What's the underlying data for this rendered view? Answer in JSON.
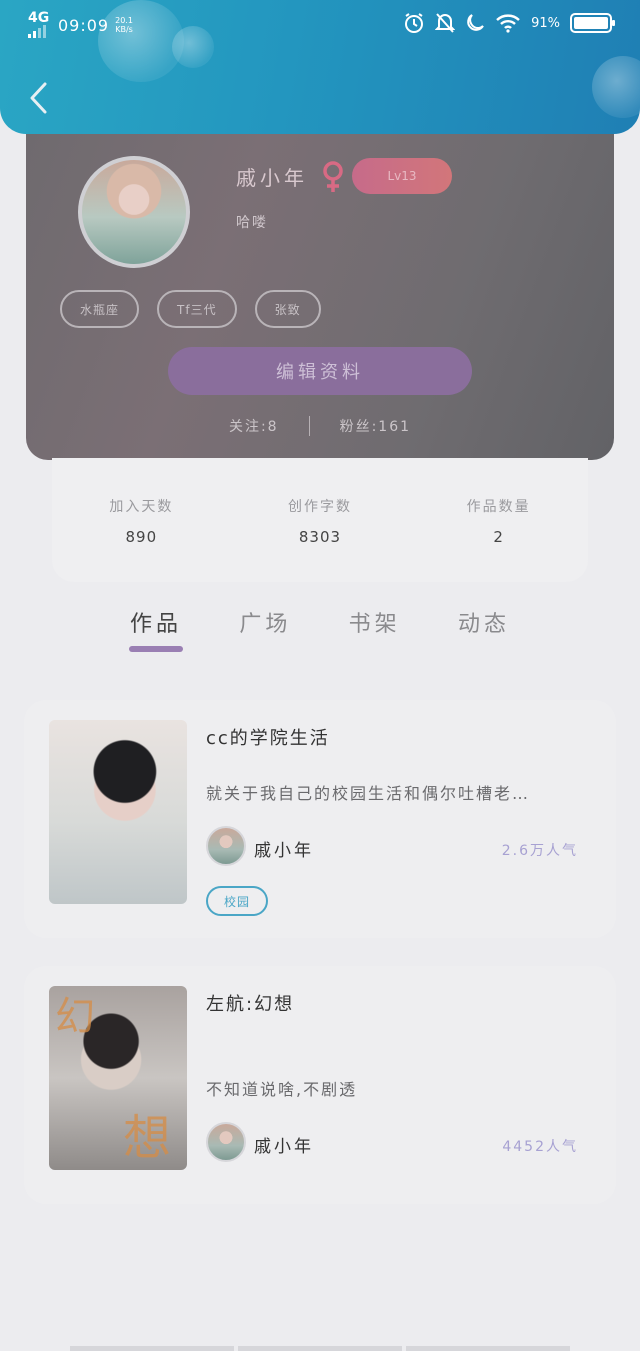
{
  "status_bar": {
    "network": "4G",
    "time": "09:09",
    "speed_value": "20.1",
    "speed_unit": "KB/s",
    "battery": "91%"
  },
  "header": {
    "back_icon": "chevron-left-icon"
  },
  "profile": {
    "nickname": "戚小年",
    "gender_icon": "female-symbol-icon",
    "gender_color": "#d86a84",
    "level": "Lv13",
    "signature": "哈喽",
    "tags": [
      "水瓶座",
      "Tf三代",
      "张致"
    ],
    "edit_button": "编辑资料",
    "following": "关注:8",
    "fans": "粉丝:161"
  },
  "stats": [
    {
      "label": "加入天数",
      "value": "890"
    },
    {
      "label": "创作字数",
      "value": "8303"
    },
    {
      "label": "作品数量",
      "value": "2"
    }
  ],
  "tabs": [
    {
      "label": "作品",
      "active": true
    },
    {
      "label": "广场",
      "active": false
    },
    {
      "label": "书架",
      "active": false
    },
    {
      "label": "动态",
      "active": false
    }
  ],
  "works": [
    {
      "title": "cc的学院生活",
      "description": "就关于我自己的校园生活和偶尔吐槽老…",
      "author": "戚小年",
      "popularity": "2.6万人气",
      "tag": "校园"
    },
    {
      "title": "左航:幻想",
      "description": "不知道说啥,不剧透",
      "author": "戚小年",
      "popularity": "4452人气",
      "cover_text_top": "幻",
      "cover_text_bottom": "想"
    }
  ],
  "colors": {
    "header_blue": "#2396bf",
    "accent_purple": "#9a7fb3",
    "tag_blue": "#4aa6c6",
    "popularity_purple": "#a7a1d2"
  }
}
